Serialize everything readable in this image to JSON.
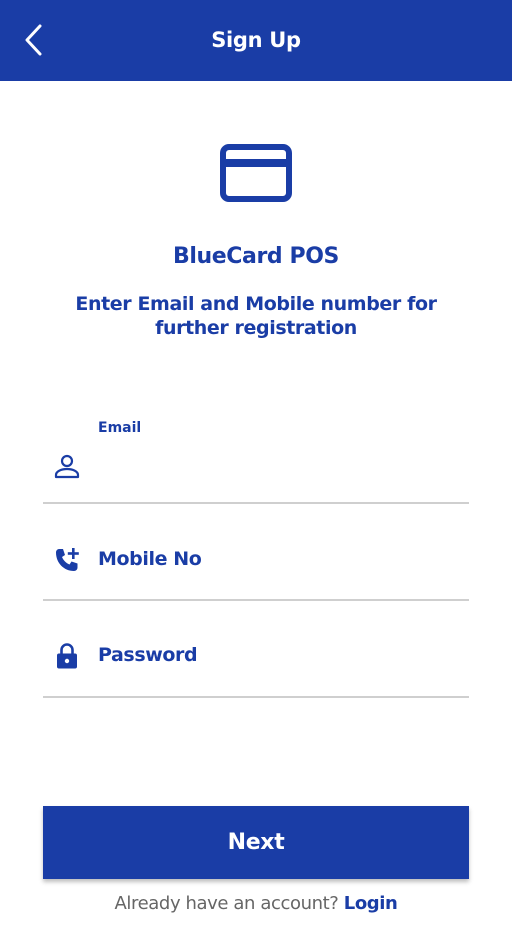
{
  "colors": {
    "primary": "#1a3da6",
    "background": "#ffffff",
    "divider": "#cfcfcf",
    "muted_text": "#666666"
  },
  "header": {
    "title": "Sign Up",
    "back_icon": "chevron-left-icon"
  },
  "brand": {
    "icon": "credit-card-icon",
    "app_name": "BlueCard POS"
  },
  "subtitle": "Enter Email and Mobile number for further registration",
  "form": {
    "email": {
      "label": "Email",
      "icon": "person-icon",
      "value": ""
    },
    "mobile": {
      "label": "Mobile No",
      "icon": "phone-add-icon"
    },
    "password": {
      "label": "Password",
      "icon": "lock-icon"
    }
  },
  "next_label": "Next",
  "footer": {
    "prompt": "Already have an account?",
    "login_label": "Login"
  }
}
